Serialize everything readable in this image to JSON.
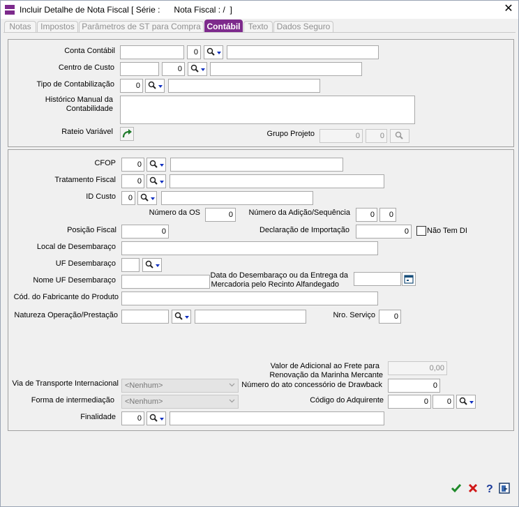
{
  "window": {
    "title": "Incluir Detalhe de Nota Fiscal [ Série :      Nota Fiscal : /  ]"
  },
  "tabs": [
    {
      "label": "Notas"
    },
    {
      "label": "Impostos"
    },
    {
      "label": "Parâmetros de ST para Compra"
    },
    {
      "label": "Contábil",
      "active": true
    },
    {
      "label": "Texto"
    },
    {
      "label": "Dados Seguro"
    }
  ],
  "accent_color": "#7d2a8c",
  "contabil": {
    "conta_contabil": {
      "label": "Conta Contábil",
      "code": "",
      "num": "0",
      "desc": ""
    },
    "centro_custo": {
      "label": "Centro de Custo",
      "code": "",
      "num": "0",
      "desc": ""
    },
    "tipo_contabilizacao": {
      "label": "Tipo de Contabilização",
      "num": "0",
      "desc": ""
    },
    "historico": {
      "label_1": "Histórico Manual da",
      "label_2": "Contabilidade",
      "value": ""
    },
    "rateio": {
      "label": "Rateio Variável"
    },
    "grupo_projeto": {
      "label": "Grupo Projeto",
      "value1": "0",
      "value2": "0"
    }
  },
  "fiscal": {
    "cfop": {
      "label": "CFOP",
      "num": "0",
      "desc": ""
    },
    "tratamento": {
      "label": "Tratamento Fiscal",
      "num": "0",
      "desc": ""
    },
    "id_custo": {
      "label": "ID Custo",
      "num": "0",
      "desc": ""
    },
    "numero_os": {
      "label": "Número da OS",
      "value": "0"
    },
    "numero_adicao": {
      "label": "Número da Adição/Sequência",
      "value1": "0",
      "value2": "0"
    },
    "posicao_fiscal": {
      "label": "Posição Fiscal",
      "value": "0"
    },
    "declaracao": {
      "label": "Declaração de Importação",
      "value": "0"
    },
    "nao_tem_di": {
      "label": "Não Tem  DI",
      "checked": false
    },
    "local_desembaraco": {
      "label": "Local de Desembaraço",
      "value": ""
    },
    "uf_desembaraco": {
      "label": "UF Desembaraço",
      "value": ""
    },
    "nome_uf": {
      "label": "Nome UF Desembaraço",
      "value": ""
    },
    "data_desembaraco": {
      "label_1": "Data do Desembaraço ou da Entrega da",
      "label_2": "Mercadoria pelo Recinto Alfandegado",
      "value": ""
    },
    "cod_fabricante": {
      "label": "Cód. do Fabricante do Produto",
      "value": ""
    },
    "natureza": {
      "label": "Natureza Operação/Prestação",
      "code": "",
      "desc": ""
    },
    "nro_servico": {
      "label": "Nro. Serviço",
      "value": "0"
    },
    "valor_frete": {
      "label_1": "Valor de Adicional ao Frete para",
      "label_2": "Renovação da Marinha Mercante",
      "value": "0,00"
    },
    "via_transporte": {
      "label": "Via de Transporte Internacional",
      "value": "<Nenhum>"
    },
    "numero_drawback": {
      "label": "Número do ato concessório de Drawback",
      "value": "0"
    },
    "forma_intermediacao": {
      "label": "Forma de intermediação",
      "value": "<Nenhum>"
    },
    "codigo_adquirente": {
      "label": "Código do Adquirente",
      "value1": "0",
      "value2": "0"
    },
    "finalidade": {
      "label": "Finalidade",
      "num": "0",
      "desc": ""
    }
  },
  "footer": {
    "icons": [
      "confirm-icon",
      "cancel-icon",
      "help-icon",
      "exit-icon"
    ]
  }
}
